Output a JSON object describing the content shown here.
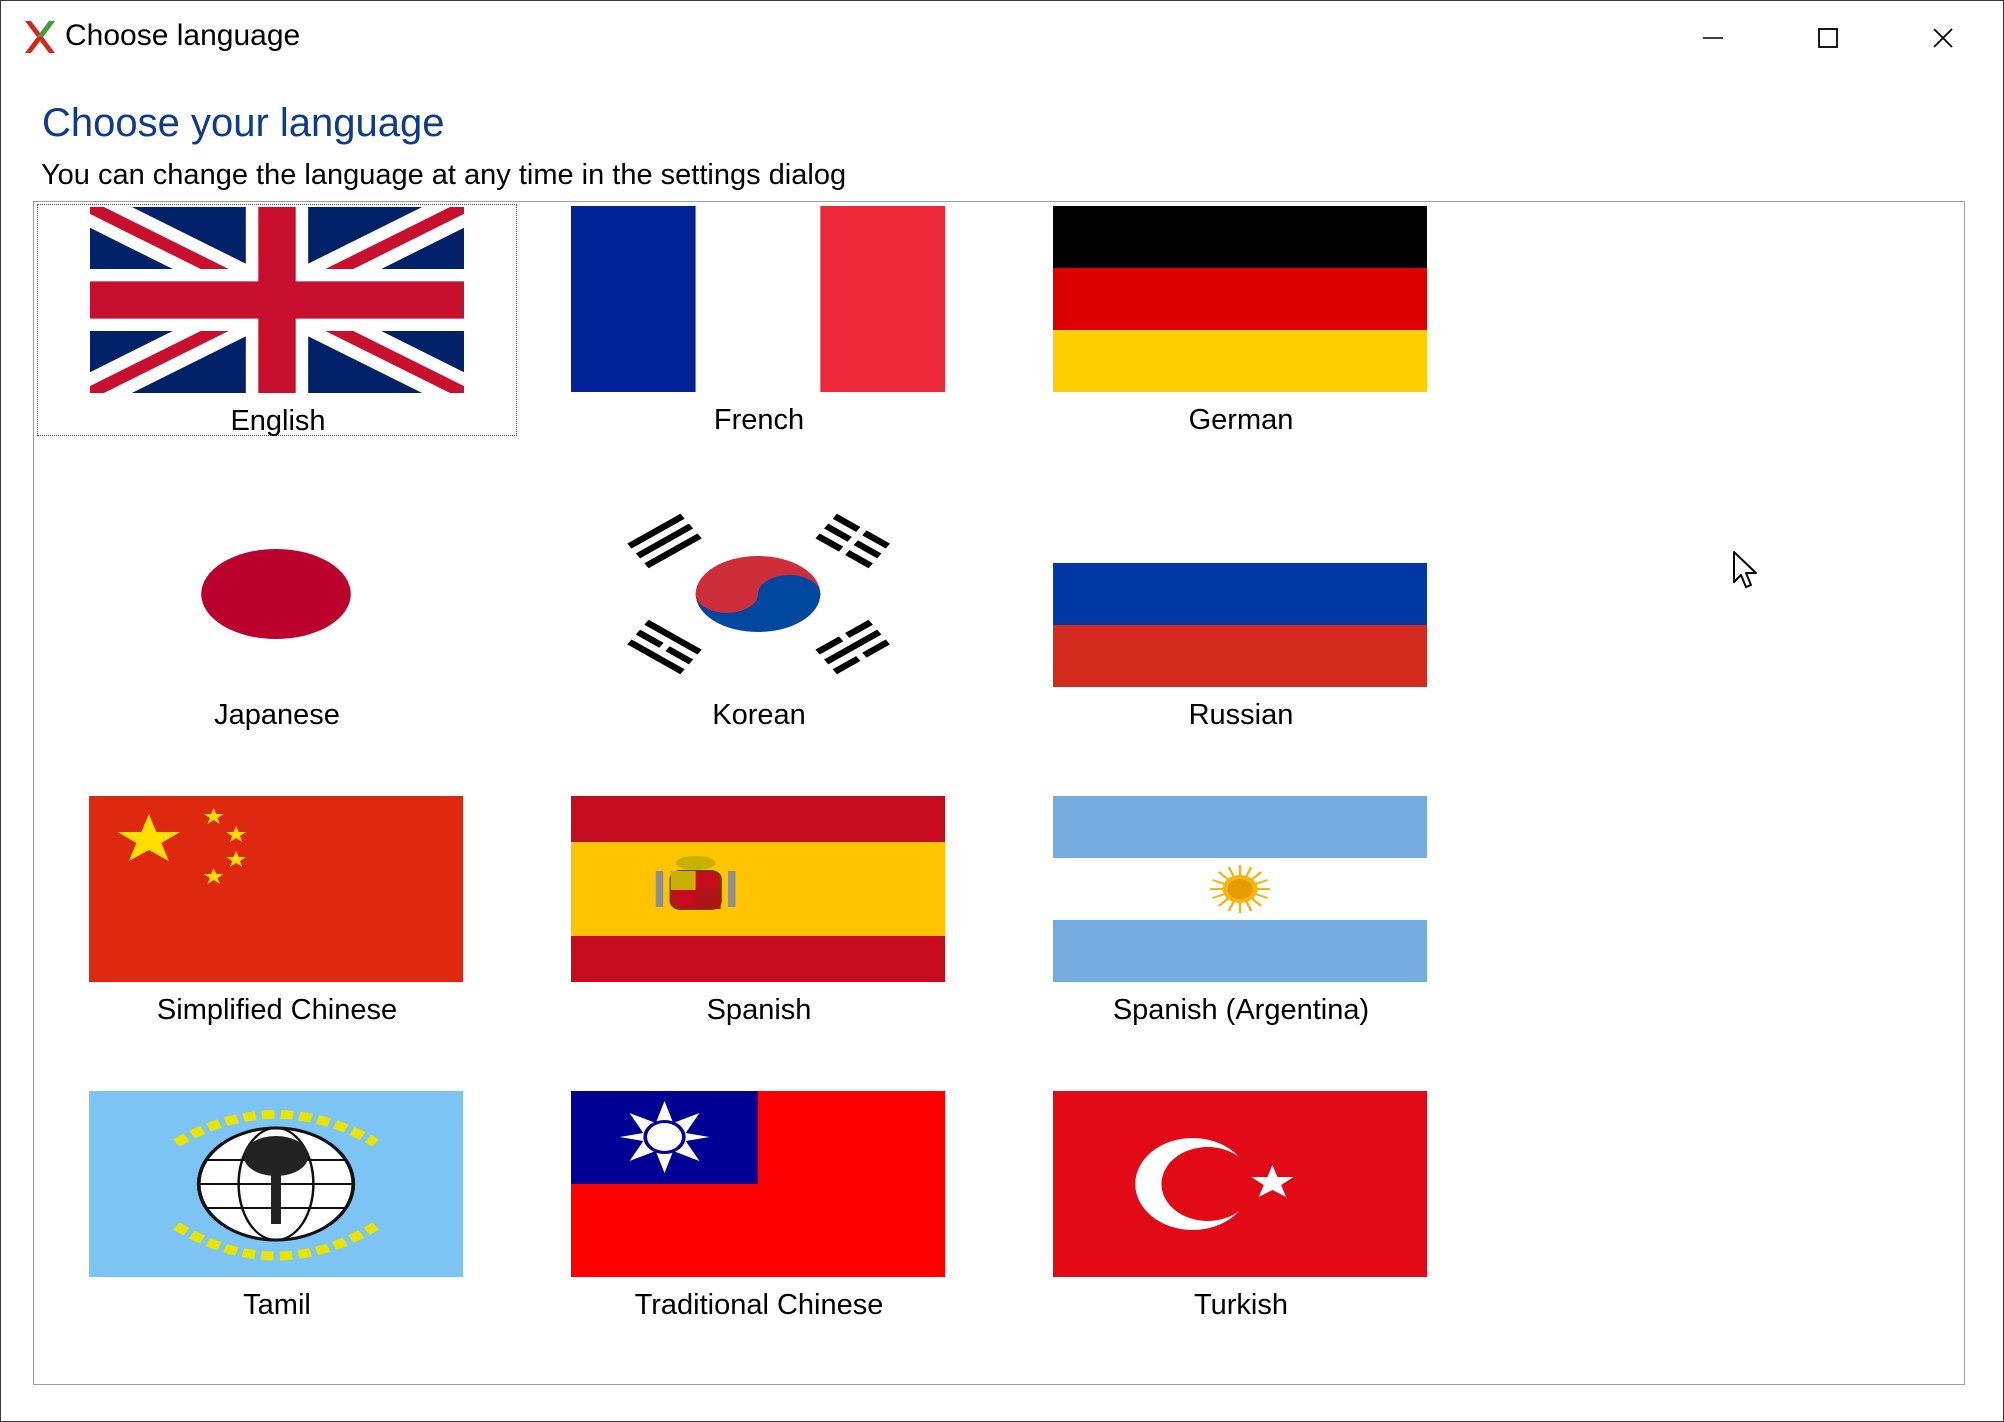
{
  "window": {
    "title": "Choose language",
    "controls": {
      "minimize": "minimize",
      "maximize": "maximize",
      "close": "close"
    }
  },
  "header": {
    "heading": "Choose your language",
    "subtext": "You can change the language at any time in the settings dialog"
  },
  "languages": [
    {
      "label": "English",
      "flag": "uk-flag-icon",
      "selected": true
    },
    {
      "label": "French",
      "flag": "france-flag-icon"
    },
    {
      "label": "German",
      "flag": "germany-flag-icon"
    },
    {
      "label": "Japanese",
      "flag": "japan-flag-icon"
    },
    {
      "label": "Korean",
      "flag": "korea-flag-icon"
    },
    {
      "label": "Russian",
      "flag": "russia-flag-icon"
    },
    {
      "label": "Simplified Chinese",
      "flag": "china-flag-icon"
    },
    {
      "label": "Spanish",
      "flag": "spain-flag-icon"
    },
    {
      "label": "Spanish (Argentina)",
      "flag": "argentina-flag-icon"
    },
    {
      "label": "Tamil",
      "flag": "tamil-flag-icon"
    },
    {
      "label": "Traditional Chinese",
      "flag": "taiwan-flag-icon"
    },
    {
      "label": "Turkish",
      "flag": "turkey-flag-icon"
    }
  ],
  "colors": {
    "heading": "#0f3a93",
    "uk_blue": "#012169",
    "uk_red": "#c8102e",
    "france_blue": "#002395",
    "france_red": "#ed2939",
    "germany_red": "#dd0000",
    "germany_gold": "#ffce00",
    "japan_red": "#bc002d",
    "russia_blue": "#0039a6",
    "russia_red": "#d52b1e",
    "china_red": "#de2910",
    "china_yellow": "#ffde00",
    "spain_red": "#c60b1e",
    "spain_yellow": "#ffc400",
    "argentina_blue": "#74acdf",
    "argentina_sun": "#f6b40e",
    "tamil_blue": "#7cc4f4",
    "taiwan_blue": "#000095",
    "taiwan_red": "#fe0000",
    "turkey_red": "#e30a17"
  }
}
